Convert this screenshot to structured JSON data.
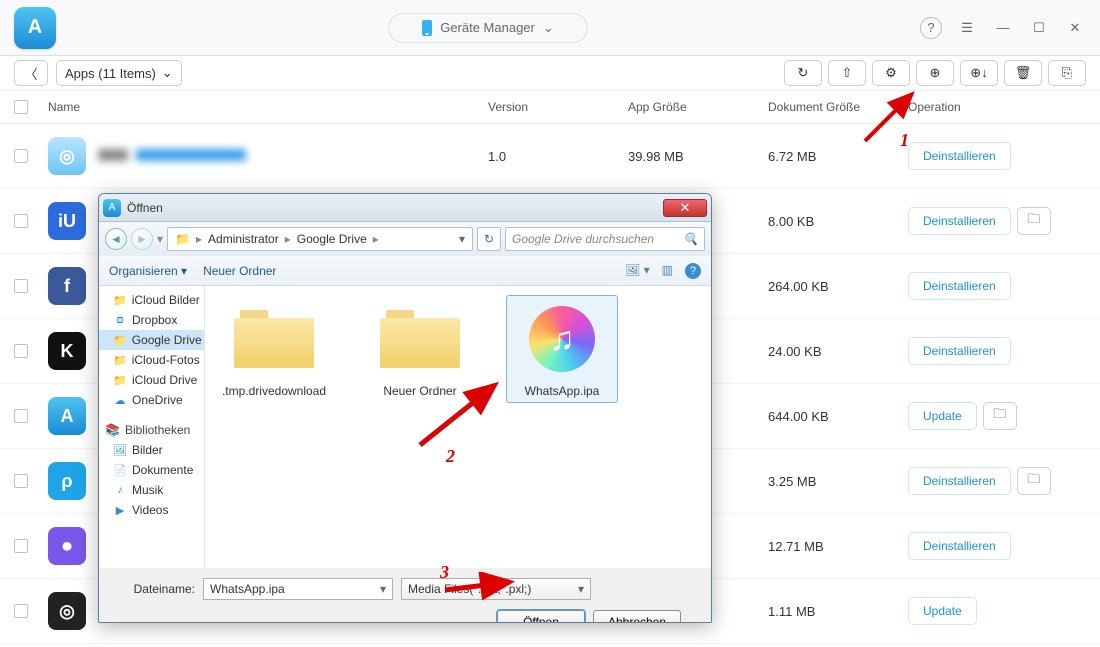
{
  "header": {
    "title": "Geräte Manager"
  },
  "subbar": {
    "selector": "Apps (11 Items)"
  },
  "columns": {
    "name": "Name",
    "version": "Version",
    "size": "App Größe",
    "doc": "Dokument Größe",
    "op": "Operation"
  },
  "apps": [
    {
      "ver": "1.0",
      "size": "39.98 MB",
      "doc": "6.72 MB",
      "op": "Deinstallieren",
      "color": "linear-gradient(180deg,#b9e5ff,#6ec4f6)",
      "glyph": "◎",
      "folder": false
    },
    {
      "ver": "",
      "size": "",
      "doc": "8.00 KB",
      "op": "Deinstallieren",
      "color": "#2b6bdc",
      "glyph": "iU",
      "folder": true
    },
    {
      "ver": "",
      "size": "",
      "doc": "264.00 KB",
      "op": "Deinstallieren",
      "color": "#3b5998",
      "glyph": "f",
      "folder": false
    },
    {
      "ver": "",
      "size": "",
      "doc": "24.00 KB",
      "op": "Deinstallieren",
      "color": "#111",
      "glyph": "K",
      "folder": false
    },
    {
      "ver": "",
      "size": "",
      "doc": "644.00 KB",
      "op": "Update",
      "color": "linear-gradient(180deg,#4fc4f0,#1b8bd8)",
      "glyph": "A",
      "folder": true
    },
    {
      "ver": "",
      "size": "",
      "doc": "3.25 MB",
      "op": "Deinstallieren",
      "color": "#1fa4ea",
      "glyph": "ρ",
      "folder": true
    },
    {
      "ver": "",
      "size": "",
      "doc": "12.71 MB",
      "op": "Deinstallieren",
      "color": "#7a56ea",
      "glyph": "⏺",
      "folder": false
    },
    {
      "ver": "",
      "size": "",
      "doc": "1.11 MB",
      "op": "Update",
      "color": "#222",
      "glyph": "◎",
      "folder": false
    }
  ],
  "dialog": {
    "title": "Öffnen",
    "crumb1": "Administrator",
    "crumb2": "Google Drive",
    "searchPlaceholder": "Google Drive durchsuchen",
    "organise": "Organisieren",
    "neworder": "Neuer Ordner",
    "side": {
      "icloudBilder": "iCloud Bilder",
      "dropbox": "Dropbox",
      "gdrive": "Google Drive",
      "icloudFotos": "iCloud-Fotos",
      "icloudDrive": "iCloud Drive",
      "onedrive": "OneDrive",
      "biblio": "Bibliotheken",
      "bilder": "Bilder",
      "dokumente": "Dokumente",
      "musik": "Musik",
      "videos": "Videos"
    },
    "files": {
      "tmp": ".tmp.drivedownload",
      "neuer": "Neuer Ordner",
      "wa": "WhatsApp.ipa"
    },
    "footer": {
      "dateiname": "Dateiname:",
      "value": "WhatsApp.ipa",
      "filter": "Media Files(*.ipa;*.pxl;)",
      "open": "Öffnen",
      "cancel": "Abbrechen"
    }
  },
  "annot": {
    "n1": "1",
    "n2": "2",
    "n3": "3"
  }
}
